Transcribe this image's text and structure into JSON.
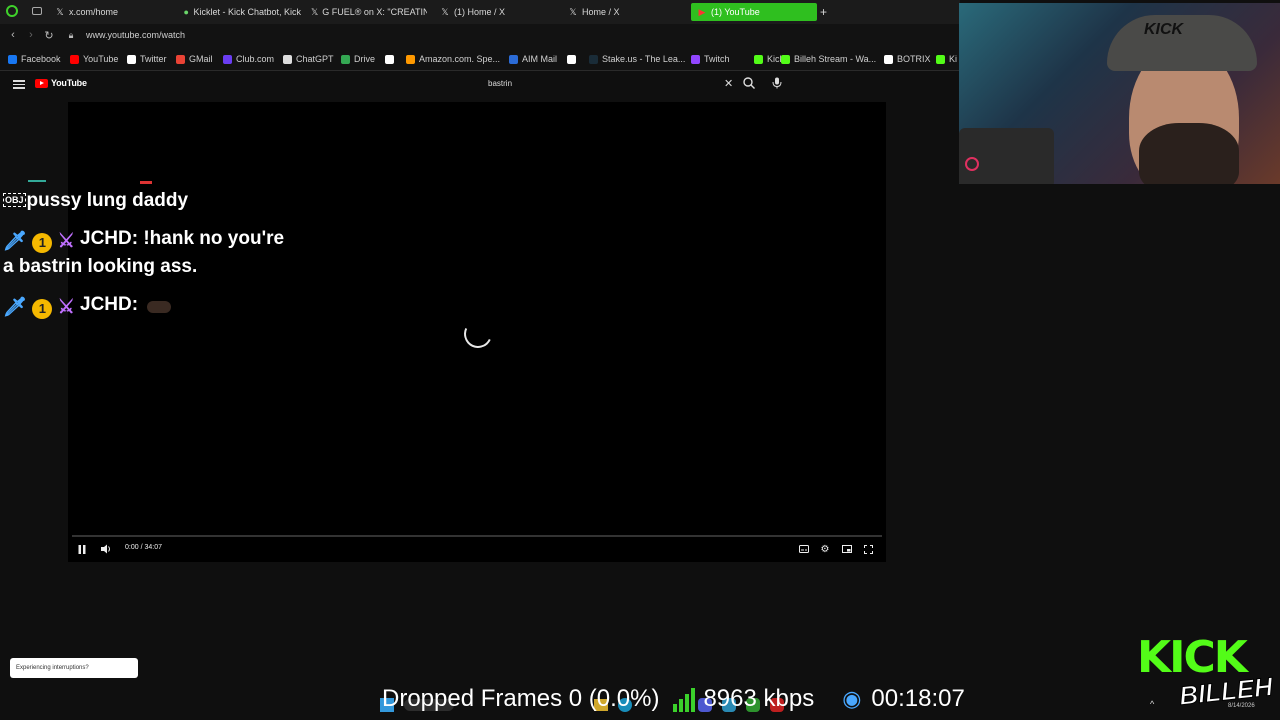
{
  "browser": {
    "tabs": [
      {
        "label": "x.com/home",
        "icon": "x-icon"
      },
      {
        "label": "Kicklet - Kick Chatbot, Kick",
        "icon": "kicklet-icon"
      },
      {
        "label": "G FUEL® on X: \"CREATING",
        "icon": "x-icon"
      },
      {
        "label": "(1) Home / X",
        "icon": "x-icon"
      },
      {
        "label": "Home / X",
        "icon": "x-icon"
      },
      {
        "label": "(1) YouTube",
        "icon": "youtube-icon",
        "active": true
      }
    ],
    "new_tab": "+",
    "url": "www.youtube.com/watch",
    "bookmarks": [
      {
        "label": "Facebook",
        "color": "#1877f2"
      },
      {
        "label": "YouTube",
        "color": "#ff0000"
      },
      {
        "label": "Twitter",
        "color": "#ffffff"
      },
      {
        "label": "GMail",
        "color": "#ea4335"
      },
      {
        "label": "Club.com",
        "color": "#6a3df2"
      },
      {
        "label": "ChatGPT",
        "color": "#dddddd"
      },
      {
        "label": "Drive",
        "color": "#34a853"
      },
      {
        "label": "",
        "color": "#ffffff"
      },
      {
        "label": "Amazon.com. Spe...",
        "color": "#ff9900"
      },
      {
        "label": "AIM Mail",
        "color": "#2b6bd6"
      },
      {
        "label": "",
        "color": "#ffffff"
      },
      {
        "label": "Stake.us - The Lea...",
        "color": "#1a2c38"
      },
      {
        "label": "Twitch",
        "color": "#9146ff"
      },
      {
        "label": "Kick",
        "color": "#53fc18"
      },
      {
        "label": "Billeh Stream - Wa...",
        "color": "#53fc18"
      },
      {
        "label": "BOTRIX",
        "color": "#ffffff"
      },
      {
        "label": "Ki",
        "color": "#53fc18"
      }
    ]
  },
  "youtube": {
    "logo": "YouTube",
    "search_value": "bastrin",
    "player": {
      "time": "0:00 / 34:07",
      "progress": 0.0
    }
  },
  "chat": {
    "line1": "pussy lung daddy",
    "line1_badge": "OBJ",
    "msg2_user": "JCHD:",
    "msg2_text_a": "!hank no you're",
    "msg2_text_b": "a bastrin looking ass.",
    "msg3_user": "JCHD:"
  },
  "overlay": {
    "interruptions": "Experiencing interruptions?",
    "dropped_frames": "Dropped Frames 0 (0.0%)",
    "bitrate": "8963 kbps",
    "uptime": "00:18:07",
    "brand_top": "KICK",
    "brand_bottom": "BILLEH"
  },
  "taskbar": {
    "date": "8/14/2026"
  },
  "colors": {
    "accent_green": "#53fc18",
    "tab_active": "#2fbf1f",
    "yt_red": "#ff0000"
  }
}
